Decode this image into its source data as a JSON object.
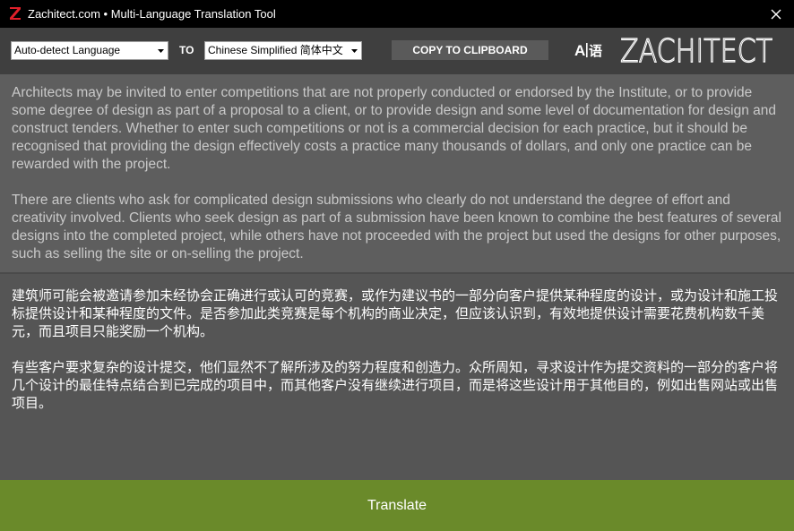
{
  "window": {
    "title": "Zachitect.com • Multi-Language Translation Tool",
    "logo_icon": "z-logo-icon",
    "close_icon": "close-icon"
  },
  "toolbar": {
    "source_language": "Auto-detect Language",
    "to_label": "TO",
    "target_language": "Chinese Simplified 简体中文",
    "copy_button_label": "COPY TO CLIPBOARD",
    "ai_badge_icon": "ai-translate-icon",
    "brand_logo": "ZACHITECT"
  },
  "source": {
    "paragraphs": [
      "Architects may be invited to enter competitions that are not properly conducted or endorsed by the Institute, or to provide some degree of design as part of a proposal to a client, or to provide design and some level of documentation for design and construct tenders. Whether to enter such competitions or not is a commercial decision for each practice, but it should be recognised that providing the design effectively costs a practice many thousands of dollars, and only one practice can be rewarded with the project.",
      "There are clients who ask for complicated design submissions who clearly do not understand the degree of effort and creativity involved. Clients who seek design as part of a submission have been known to combine the best features of several designs into the completed project, while others have not proceeded with the project but used the designs for other purposes, such as selling the site or on-selling the project."
    ]
  },
  "target": {
    "paragraphs": [
      "建筑师可能会被邀请参加未经协会正确进行或认可的竞赛，或作为建议书的一部分向客户提供某种程度的设计，或为设计和施工投标提供设计和某种程度的文件。是否参加此类竞赛是每个机构的商业决定，但应该认识到，有效地提供设计需要花费机构数千美元，而且项目只能奖励一个机构。",
      "有些客户要求复杂的设计提交，他们显然不了解所涉及的努力程度和创造力。众所周知，寻求设计作为提交资料的一部分的客户将几个设计的最佳特点结合到已完成的项目中，而其他客户没有继续进行项目，而是将这些设计用于其他目的，例如出售网站或出售项目。"
    ]
  },
  "actions": {
    "translate_label": "Translate"
  },
  "colors": {
    "titlebar": "#000000",
    "toolbar": "#3f3f3f",
    "source_pane": "#5e5e5e",
    "target_pane": "#555555",
    "translate_button": "#6a8a2a",
    "logo_red": "#e0202a"
  }
}
